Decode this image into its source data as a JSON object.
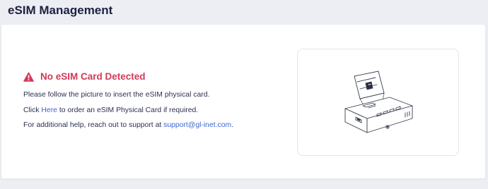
{
  "header": {
    "title": "eSIM Management"
  },
  "alert": {
    "icon": "warning-triangle-icon",
    "color": "#d03a57",
    "title": "No eSIM Card Detected"
  },
  "instructions": {
    "line1": "Please follow the picture to insert the eSIM physical card.",
    "line2_prefix": "Click ",
    "line2_link": "Here",
    "line2_suffix": " to order an eSIM Physical Card if required.",
    "line3_prefix": "For additional help, reach out to support at ",
    "line3_link": "support@gl-inet.com",
    "line3_suffix": "."
  },
  "colors": {
    "link": "#3d66d6",
    "text": "#2c3050",
    "background": "#eceef3"
  },
  "illustration": {
    "icon": "device-sim-insert-illustration"
  }
}
